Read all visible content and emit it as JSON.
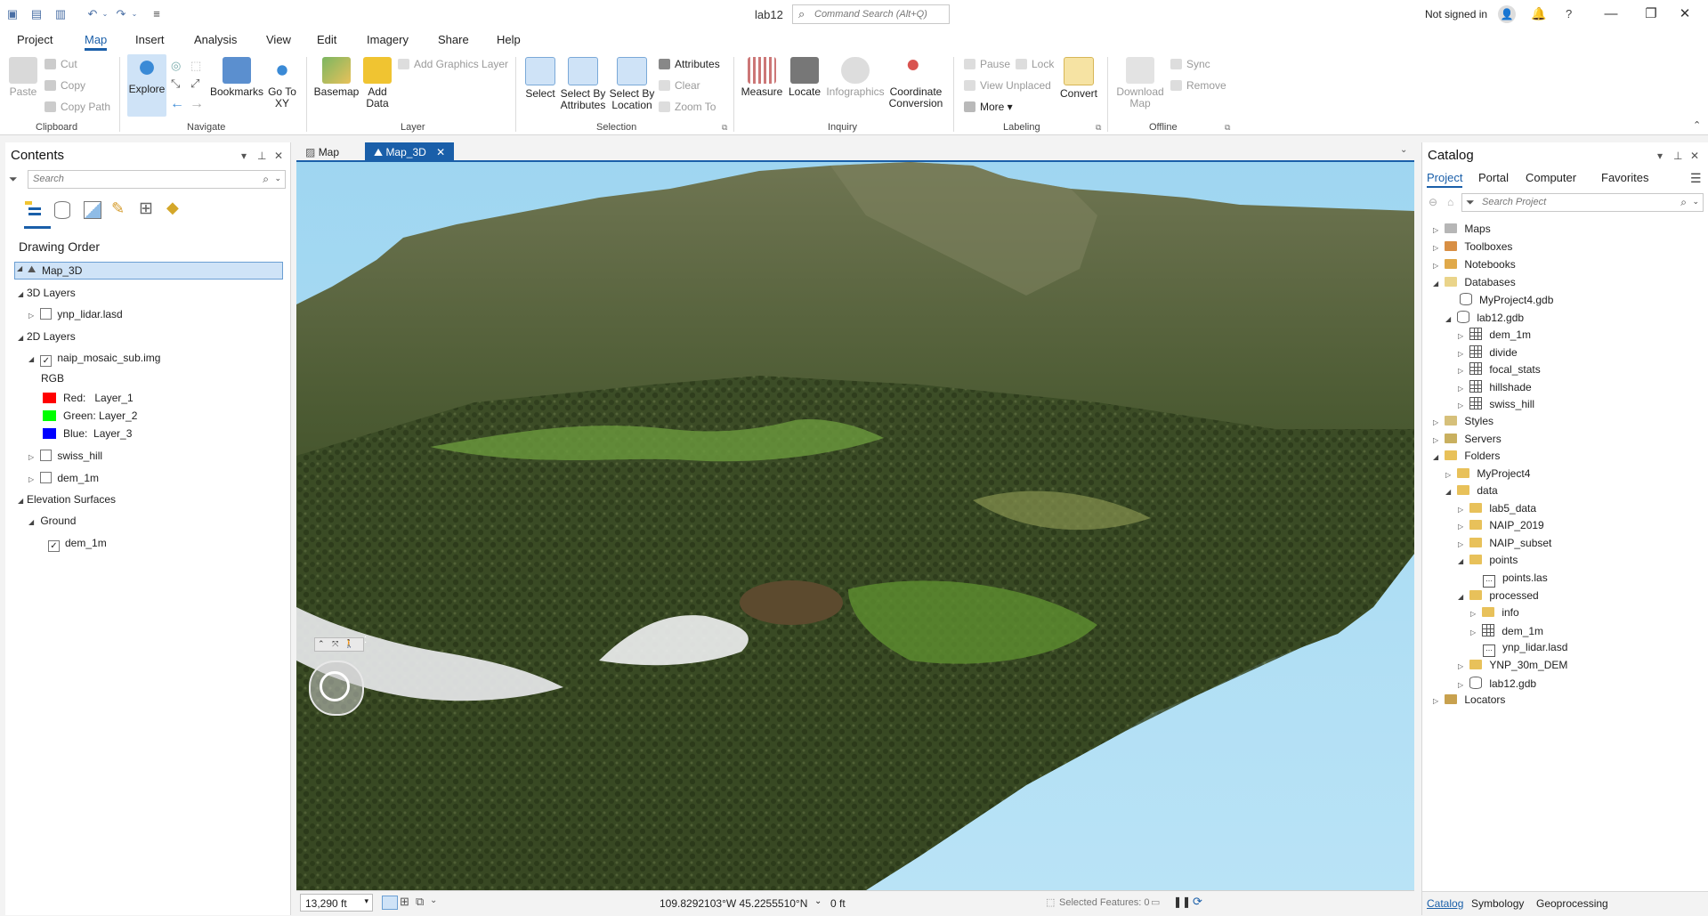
{
  "app": {
    "title": "lab12",
    "command_search_placeholder": "Command Search (Alt+Q)",
    "sign_in_status": "Not signed in"
  },
  "menu_tabs": [
    "Project",
    "Map",
    "Insert",
    "Analysis",
    "View",
    "Edit",
    "Imagery",
    "Share",
    "Help"
  ],
  "active_menu_tab": "Map",
  "ribbon": {
    "clipboard": {
      "paste": "Paste",
      "cut": "Cut",
      "copy": "Copy",
      "copy_path": "Copy Path",
      "group": "Clipboard"
    },
    "navigate": {
      "explore": "Explore",
      "bookmarks": "Bookmarks",
      "go_to_xy": "Go To XY",
      "group": "Navigate"
    },
    "layer": {
      "basemap": "Basemap",
      "add_data": "Add Data",
      "add_graphics_layer": "Add Graphics Layer",
      "group": "Layer"
    },
    "selection": {
      "select": "Select",
      "select_by_attributes": "Select By Attributes",
      "select_by_location": "Select By Location",
      "attributes": "Attributes",
      "clear": "Clear",
      "zoom_to": "Zoom To",
      "group": "Selection"
    },
    "inquiry": {
      "measure": "Measure",
      "locate": "Locate",
      "infographics": "Infographics",
      "coordinate_conversion": "Coordinate Conversion",
      "group": "Inquiry"
    },
    "labeling": {
      "pause": "Pause",
      "lock": "Lock",
      "view_unplaced": "View Unplaced",
      "more": "More",
      "convert": "Convert",
      "group": "Labeling"
    },
    "offline": {
      "download_map": "Download Map",
      "sync": "Sync",
      "remove": "Remove",
      "group": "Offline"
    }
  },
  "contents": {
    "title": "Contents",
    "search_placeholder": "Search",
    "drawing_order_label": "Drawing Order",
    "map_name": "Map_3D",
    "groups": {
      "layers_3d": "3D Layers",
      "layer_lasd": "ynp_lidar.lasd",
      "layers_2d": "2D Layers",
      "layer_naip": "naip_mosaic_sub.img",
      "rgb_label": "RGB",
      "red": "Red:   Layer_1",
      "green": "Green: Layer_2",
      "blue": "Blue:  Layer_3",
      "layer_swiss": "swiss_hill",
      "layer_dem": "dem_1m",
      "elevation_surfaces": "Elevation Surfaces",
      "ground": "Ground",
      "ground_dem": "dem_1m"
    },
    "colors": {
      "red": "#ff0000",
      "green": "#00ff00",
      "blue": "#0000ff"
    }
  },
  "map_tabs": [
    {
      "label": "Map"
    },
    {
      "label": "Map_3D"
    }
  ],
  "map_status": {
    "scale": "13,290 ft",
    "coordinates": "109.8292103°W 45.2255510°N",
    "elevation": "0 ft",
    "selected_features": "Selected Features: 0"
  },
  "catalog": {
    "title": "Catalog",
    "tabs": [
      "Project",
      "Portal",
      "Computer",
      "Favorites"
    ],
    "search_placeholder": "Search Project",
    "tree": {
      "maps": "Maps",
      "toolboxes": "Toolboxes",
      "notebooks": "Notebooks",
      "databases": "Databases",
      "myproject4_gdb": "MyProject4.gdb",
      "lab12_gdb": "lab12.gdb",
      "dem_1m": "dem_1m",
      "divide": "divide",
      "focal_stats": "focal_stats",
      "hillshade": "hillshade",
      "swiss_hill": "swiss_hill",
      "styles": "Styles",
      "servers": "Servers",
      "folders": "Folders",
      "myproject4": "MyProject4",
      "data": "data",
      "lab5_data": "lab5_data",
      "naip_2019": "NAIP_2019",
      "naip_subset": "NAIP_subset",
      "points": "points",
      "points_las": "points.las",
      "processed": "processed",
      "info": "info",
      "processed_dem": "dem_1m",
      "ynp_lidar": "ynp_lidar.lasd",
      "ynp_30m_dem": "YNP_30m_DEM",
      "lab12_gdb2": "lab12.gdb",
      "locators": "Locators"
    },
    "bottom_tabs": [
      "Catalog",
      "Symbology",
      "Geoprocessing"
    ]
  }
}
